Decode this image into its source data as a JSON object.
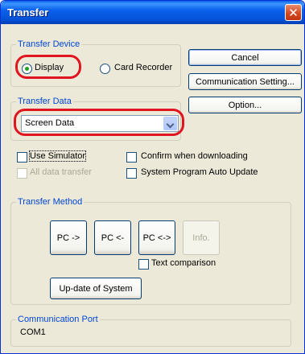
{
  "dialog": {
    "title": "Transfer",
    "close_icon": "close-icon"
  },
  "transfer_device": {
    "label": "Transfer Device",
    "options": [
      "Display",
      "Card Recorder"
    ],
    "selected": "Display"
  },
  "buttons": {
    "cancel": "Cancel",
    "communication_setting": "Communication Setting...",
    "option": "Option..."
  },
  "transfer_data": {
    "label": "Transfer Data",
    "value": "Screen Data"
  },
  "checks": {
    "use_simulator": "Use Simulator",
    "all_data_transfer": "All data transfer",
    "confirm_downloading": "Confirm when downloading",
    "system_program_update": "System Program Auto Update"
  },
  "transfer_method": {
    "label": "Transfer Method",
    "pc_to": "PC ->",
    "pc_from": "PC <-",
    "pc_both": "PC <->",
    "info": "Info.",
    "text_comparison": "Text comparison",
    "update_system": "Up-date of System"
  },
  "communication_port": {
    "label": "Communication Port",
    "value": "COM1"
  },
  "colors": {
    "highlight": "#e0151f",
    "titlebar": "#0552d8",
    "group_label": "#0046d5"
  }
}
